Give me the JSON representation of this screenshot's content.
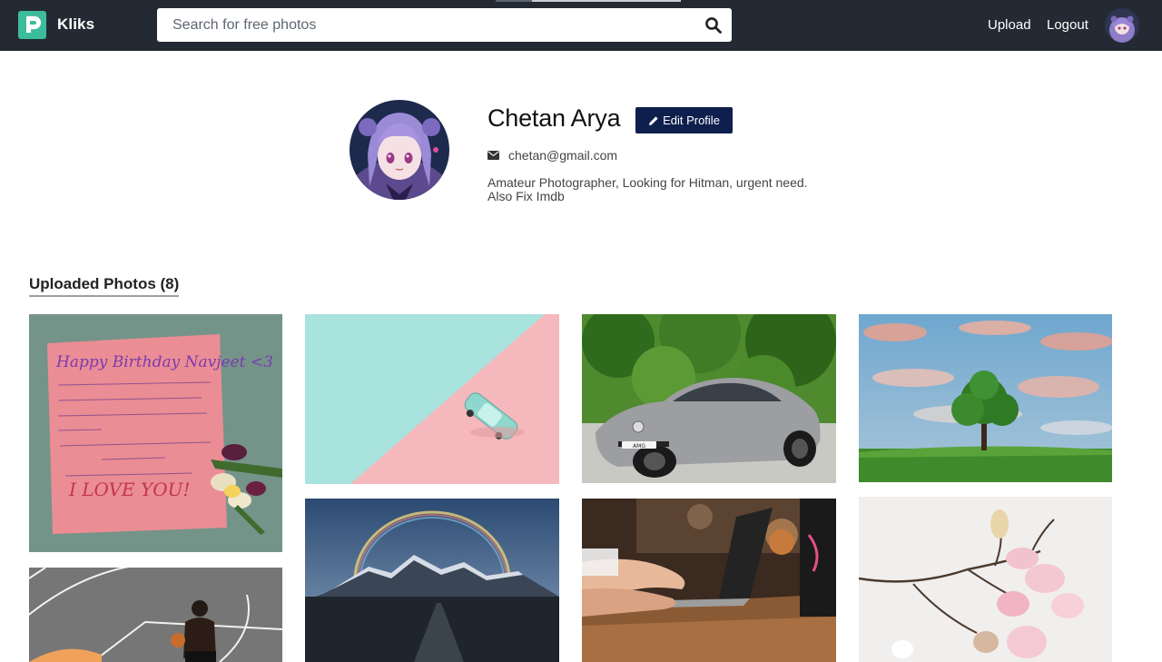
{
  "nav": {
    "brand": "Kliks",
    "search_placeholder": "Search for free photos",
    "upload_label": "Upload",
    "logout_label": "Logout"
  },
  "profile": {
    "name": "Chetan Arya",
    "edit_label": "Edit Profile",
    "email": "chetan@gmail.com",
    "bio": "Amateur Photographer, Looking for Hitman, urgent need. Also Fix Imdb"
  },
  "uploads": {
    "title": "Uploaded Photos (8)",
    "photos": [
      {
        "subject": "birthday-note",
        "note_lines": [
          "Happy Birthday Navjeet <3",
          "I LOVE YOU!"
        ]
      },
      {
        "subject": "basketball-player"
      },
      {
        "subject": "toy-car-pastel"
      },
      {
        "subject": "rainbow-mountains"
      },
      {
        "subject": "silver-sports-car",
        "plate_text": "AMG"
      },
      {
        "subject": "laptop-typing"
      },
      {
        "subject": "tree-on-hill"
      },
      {
        "subject": "magnolia-branch"
      }
    ]
  },
  "colors": {
    "navbar": "#232a33",
    "accent": "#3dbb9d",
    "button": "#0f1f4d"
  }
}
